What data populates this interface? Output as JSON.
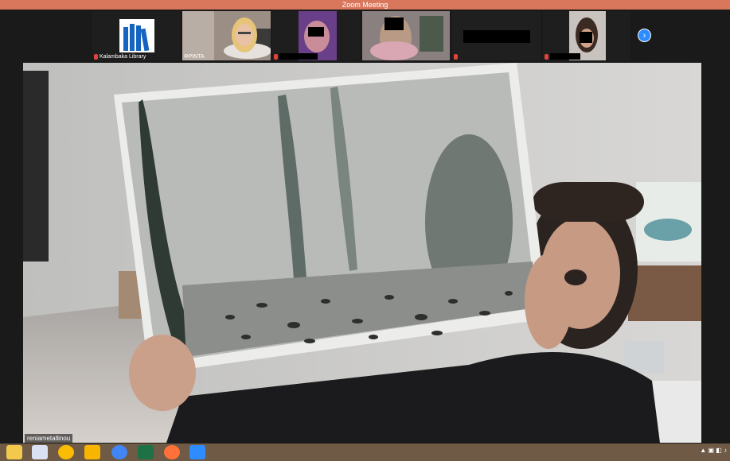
{
  "window": {
    "title": "Zoom Meeting"
  },
  "gallery": {
    "participants": [
      {
        "name": "Kalambaka Library",
        "muted": true
      },
      {
        "name": "ΦΡΙΝΤΑ",
        "muted": false
      },
      {
        "name": "",
        "muted": true
      },
      {
        "name": "",
        "muted": false
      },
      {
        "name": "",
        "muted": true
      },
      {
        "name": "",
        "muted": true
      }
    ],
    "next_icon": "chevron-right-icon"
  },
  "main": {
    "speaker_name": "reniametallinou"
  },
  "taskbar": {
    "icons": [
      "file-explorer-icon",
      "app-icon",
      "chrome-icon",
      "notes-icon",
      "chrome-icon",
      "excel-icon",
      "firefox-icon",
      "zoom-icon"
    ]
  },
  "colors": {
    "titlebar": "#d9775c",
    "accent": "#2d8cff",
    "taskbar": "#6e5a45",
    "muted_mic": "#e0433b"
  }
}
